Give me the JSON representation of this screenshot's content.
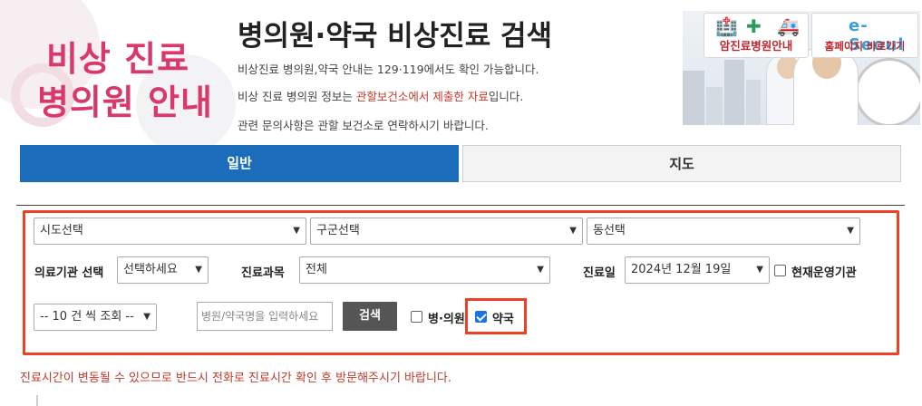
{
  "logo": {
    "line1": "비상 진료",
    "line2": "병의원 안내"
  },
  "header": {
    "title": "병의원·약국 비상진료 검색",
    "info1": "비상진료 병의원,약국 안내는 129·119에서도 확인 가능합니다.",
    "info2_pre": "비상 진료 병의원 정보는 ",
    "info2_hl": "관할보건소에서 제출한 자료",
    "info2_post": "입니다.",
    "info3": "관련 문의사항은 관할 보건소로 연락하시기 바랍니다."
  },
  "banner": {
    "cancer_hospital": "암진료병원안내",
    "homepage": "홈페이지 바로가기",
    "eseoul": "e-Seoul"
  },
  "tabs": {
    "general": "일반",
    "map": "지도"
  },
  "search": {
    "sido": "시도선택",
    "gugun": "구군선택",
    "dong": "동선택",
    "inst_type_label": "의료기관 선택",
    "inst_type_value": "선택하세요",
    "dept_label": "진료과목",
    "dept_value": "전체",
    "date_label": "진료일",
    "date_value": "2024년 12월 19일",
    "open_now_label": "현재운영기관",
    "page_size": "-- 10 건 씩 조회 --",
    "name_placeholder": "병원/약국명을 입력하세요",
    "search_button": "검색",
    "hospital_label": "병·의원",
    "pharmacy_label": "약국",
    "hospital_checked": false,
    "pharmacy_checked": true,
    "open_now_checked": false
  },
  "notice": "진료시간이 변동될 수 있으므로 반드시 전화로 진료시간 확인 후 방문해주시기 바랍니다.",
  "colors": {
    "accent": "#1b6dbc",
    "highlight_border": "#ee4022",
    "notice": "#c0392b",
    "logo": "#d9386a"
  }
}
